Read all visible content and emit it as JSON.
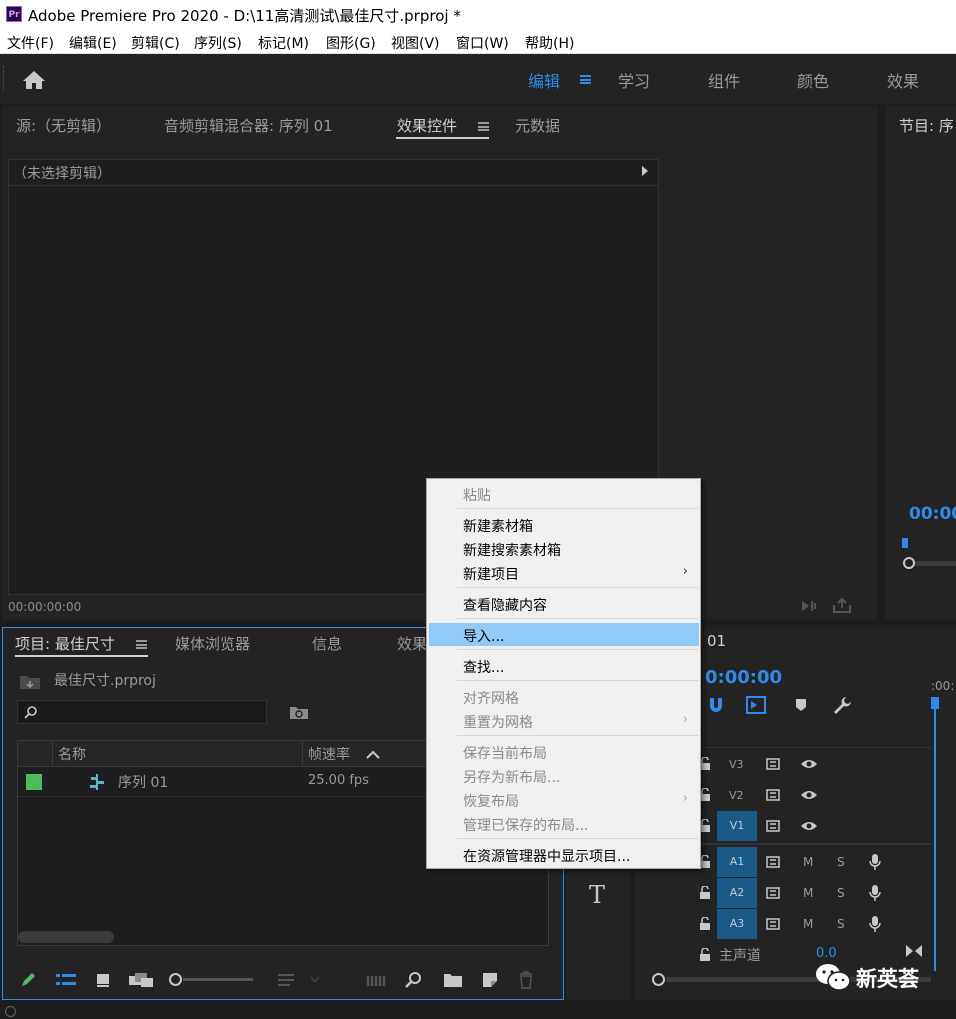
{
  "window": {
    "app_icon": "Pr",
    "title": "Adobe Premiere Pro 2020 - D:\\11高清测试\\最佳尺寸.prproj *"
  },
  "menubar": [
    "文件(F)",
    "编辑(E)",
    "剪辑(C)",
    "序列(S)",
    "标记(M)",
    "图形(G)",
    "视图(V)",
    "窗口(W)",
    "帮助(H)"
  ],
  "workspaces": {
    "active": "编辑",
    "items": [
      "学习",
      "组件",
      "颜色",
      "效果"
    ]
  },
  "source_panel": {
    "tabs": [
      "源:（无剪辑）",
      "音频剪辑混合器: 序列 01",
      "效果控件",
      "元数据"
    ],
    "no_clip": "（未选择剪辑）",
    "timecode": "00:00:00:00"
  },
  "program_panel": {
    "tab": "节目: 序",
    "timecode": "00:00"
  },
  "project_panel": {
    "tabs": [
      "项目: 最佳尺寸",
      "媒体浏览器",
      "信息",
      "效果"
    ],
    "project_file": "最佳尺寸.prproj",
    "search_value": "",
    "columns": {
      "name": "名称",
      "fps": "帧速率"
    },
    "rows": [
      {
        "name": "序列 01",
        "fps": "25.00 fps",
        "color": "#4dbb5f"
      }
    ]
  },
  "timeline": {
    "tab": "01",
    "timecode": "0:00:00",
    "ruler_label": ":00:",
    "video_tracks": [
      "V3",
      "V2",
      "V1"
    ],
    "audio_tracks": [
      "A1",
      "A2",
      "A3"
    ],
    "audio_buttons": {
      "mute": "M",
      "solo": "S"
    },
    "master": {
      "label": "主声道",
      "value": "0.0"
    }
  },
  "context_menu": {
    "items": [
      {
        "label": "粘贴",
        "disabled": true
      },
      {
        "label": "新建素材箱",
        "disabled": false
      },
      {
        "label": "新建搜索素材箱",
        "disabled": false
      },
      {
        "label": "新建项目",
        "disabled": false,
        "submenu": true
      },
      {
        "label": "查看隐藏内容",
        "disabled": false
      },
      {
        "label": "导入...",
        "disabled": false,
        "highlighted": true
      },
      {
        "label": "查找...",
        "disabled": false
      },
      {
        "label": "对齐网格",
        "disabled": true
      },
      {
        "label": "重置为网格",
        "disabled": true,
        "submenu": true
      },
      {
        "label": "保存当前布局",
        "disabled": true
      },
      {
        "label": "另存为新布局...",
        "disabled": true
      },
      {
        "label": "恢复布局",
        "disabled": true,
        "submenu": true
      },
      {
        "label": "管理已保存的布局...",
        "disabled": true
      },
      {
        "label": "在资源管理器中显示项目...",
        "disabled": false
      }
    ]
  },
  "watermark": "新英荟",
  "colors": {
    "accent": "#2d8ceb",
    "highlight": "#91c9f7",
    "track_active": "#1a5a87"
  }
}
